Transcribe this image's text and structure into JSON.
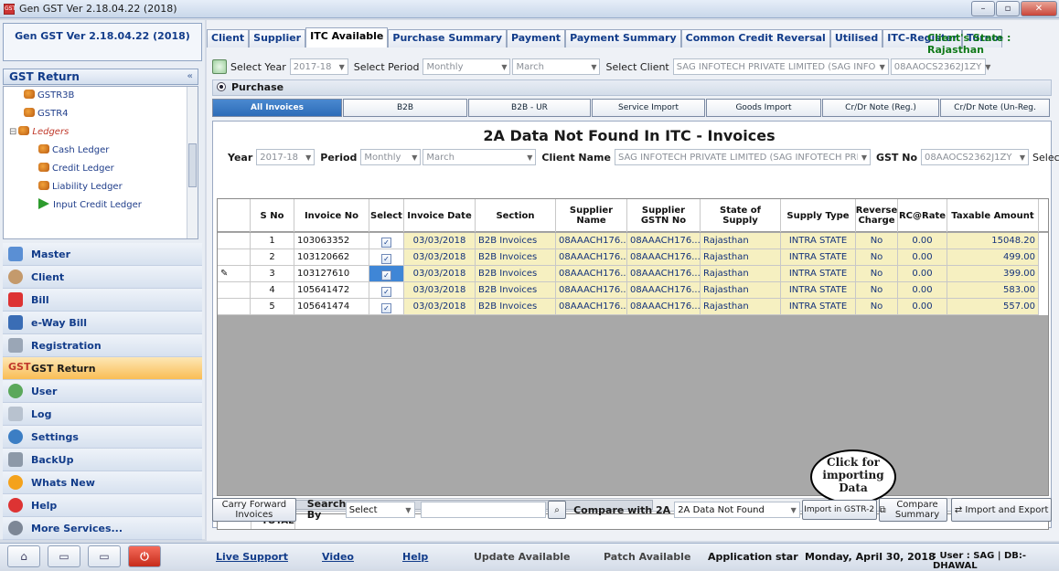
{
  "window": {
    "title": "Gen GST  Ver 2.18.04.22 (2018)",
    "icon": "GST"
  },
  "sidebar": {
    "version": "Gen GST  Ver 2.18.04.22 (2018)",
    "section_title": "GST Return",
    "tree": [
      {
        "label": "GSTR3B",
        "type": "item"
      },
      {
        "label": "GSTR4",
        "type": "item"
      },
      {
        "label": "Ledgers",
        "type": "folder"
      },
      {
        "label": "Cash Ledger",
        "type": "item"
      },
      {
        "label": "Credit Ledger",
        "type": "item"
      },
      {
        "label": "Liability Ledger",
        "type": "item"
      },
      {
        "label": "Input Credit Ledger",
        "type": "arrow"
      }
    ],
    "nav": [
      "Master",
      "Client",
      "Bill",
      "e-Way Bill",
      "Registration",
      "GST Return",
      "User",
      "Log",
      "Settings",
      "BackUp",
      "Whats New",
      "Help",
      "More Services..."
    ],
    "active_nav": "GST Return"
  },
  "tabs": [
    "Client",
    "Supplier",
    "ITC Available",
    "Purchase Summary",
    "Payment",
    "Payment Summary",
    "Common Credit Reversal",
    "Utilised",
    "ITC-Register",
    "Turnov"
  ],
  "active_tab": "ITC Available",
  "client_state": "Client's State : Rajasthan",
  "filters": {
    "year_label": "Select Year",
    "year": "2017-18",
    "period_label": "Select Period",
    "period": "Monthly",
    "month": "March",
    "client_label": "Select Client",
    "client": "SAG INFOTECH PRIVATE LIMITED (SAG INFO",
    "gstin": "08AAOCS2362J1ZY"
  },
  "purchase_label": "Purchase",
  "subtabs": [
    "All Invoices",
    "B2B",
    "B2B - UR",
    "Service Import",
    "Goods Import",
    "Cr/Dr Note (Reg.)",
    "Cr/Dr Note (Un-Reg."
  ],
  "active_subtab": "All Invoices",
  "panel": {
    "title": "2A Data Not Found In ITC - Invoices",
    "year_label": "Year",
    "year": "2017-18",
    "period_label": "Period",
    "period": "Monthly",
    "month": "March",
    "client_label": "Client Name",
    "client": "SAG INFOTECH PRIVATE LIMITED (SAG INFOTECH PRI",
    "gst_label": "GST No",
    "gst": "08AAOCS2362J1ZY",
    "select_all": "Select All"
  },
  "grid": {
    "headers": [
      "S No",
      "Invoice No",
      "Select",
      "Invoice Date",
      "Section",
      "Supplier Name",
      "Supplier GSTN No",
      "State of Supply",
      "Supply Type",
      "Reverse Charge",
      "RC@Rate",
      "Taxable Amount"
    ],
    "rows": [
      {
        "sno": "1",
        "invoice": "103063352",
        "date": "03/03/2018",
        "section": "B2B Invoices",
        "supplier": "08AAACH176...",
        "gstn": "08AAACH176...",
        "state": "Rajasthan",
        "type": "INTRA STATE",
        "rc": "No",
        "rate": "0.00",
        "amount": "15048.20"
      },
      {
        "sno": "2",
        "invoice": "103120662",
        "date": "03/03/2018",
        "section": "B2B Invoices",
        "supplier": "08AAACH176...",
        "gstn": "08AAACH176...",
        "state": "Rajasthan",
        "type": "INTRA STATE",
        "rc": "No",
        "rate": "0.00",
        "amount": "499.00"
      },
      {
        "sno": "3",
        "invoice": "103127610",
        "date": "03/03/2018",
        "section": "B2B Invoices",
        "supplier": "08AAACH176...",
        "gstn": "08AAACH176...",
        "state": "Rajasthan",
        "type": "INTRA STATE",
        "rc": "No",
        "rate": "0.00",
        "amount": "399.00"
      },
      {
        "sno": "4",
        "invoice": "105641472",
        "date": "03/03/2018",
        "section": "B2B Invoices",
        "supplier": "08AAACH176...",
        "gstn": "08AAACH176...",
        "state": "Rajasthan",
        "type": "INTRA STATE",
        "rc": "No",
        "rate": "0.00",
        "amount": "583.00"
      },
      {
        "sno": "5",
        "invoice": "105641474",
        "date": "03/03/2018",
        "section": "B2B Invoices",
        "supplier": "08AAACH176...",
        "gstn": "08AAACH176...",
        "state": "Rajasthan",
        "type": "INTRA STATE",
        "rc": "No",
        "rate": "0.00",
        "amount": "557.00"
      }
    ],
    "total_label": "TOTAL",
    "edit_icon": "pencil-icon"
  },
  "actions": {
    "carry_forward": "Carry Forward Invoices",
    "search_label": "Search By",
    "search_select": "Select",
    "compare_label": "Compare with 2A",
    "compare_value": "2A Data Not Found",
    "import_gstr2": "Import in GSTR-2",
    "compare_summary": "Compare Summary",
    "import_export": "Import and Export"
  },
  "callout": "Click for importing Data",
  "statusbar": {
    "live_support": "Live Support",
    "video": "Video",
    "help": "Help",
    "update": "Update Available",
    "patch": "Patch Available",
    "app_status": "Application star",
    "date": "Monday, April 30, 2018",
    "user": ": User : SAG | DB:-DHAWAL"
  }
}
